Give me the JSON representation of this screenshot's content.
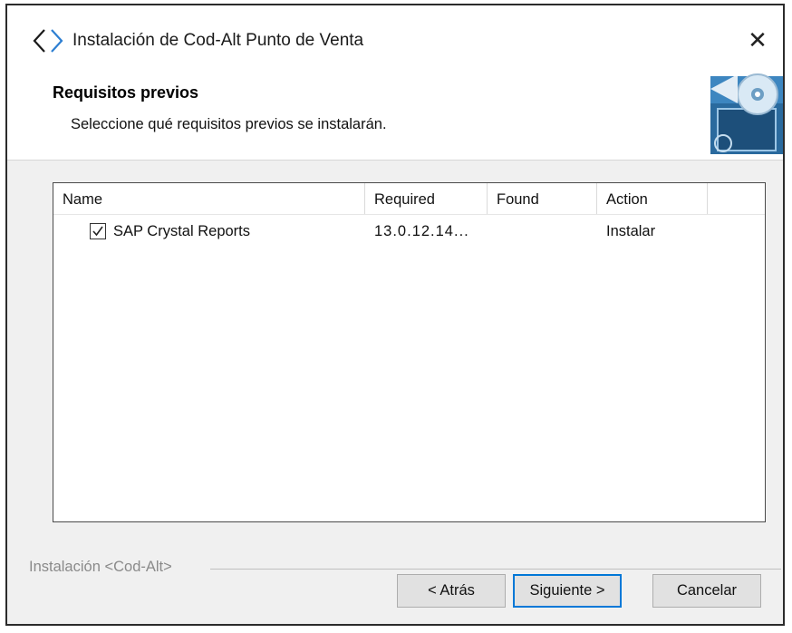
{
  "window": {
    "title": "Instalación de Cod-Alt Punto de Venta",
    "close_glyph": "✕"
  },
  "header": {
    "title": "Requisitos previos",
    "subtitle": "Seleccione qué requisitos previos se instalarán."
  },
  "list": {
    "columns": [
      "Name",
      "Required",
      "Found",
      "Action"
    ],
    "rows": [
      {
        "checked": true,
        "name": "SAP Crystal Reports",
        "required": "13.0.12.14...",
        "found": "",
        "action": "Instalar"
      }
    ]
  },
  "group": {
    "label": "Instalación <Cod-Alt>"
  },
  "buttons": {
    "back": "< Atrás",
    "next": "Siguiente >",
    "cancel": "Cancelar"
  },
  "colors": {
    "accent": "#0078d7",
    "window_bg": "#f0f0f0"
  }
}
